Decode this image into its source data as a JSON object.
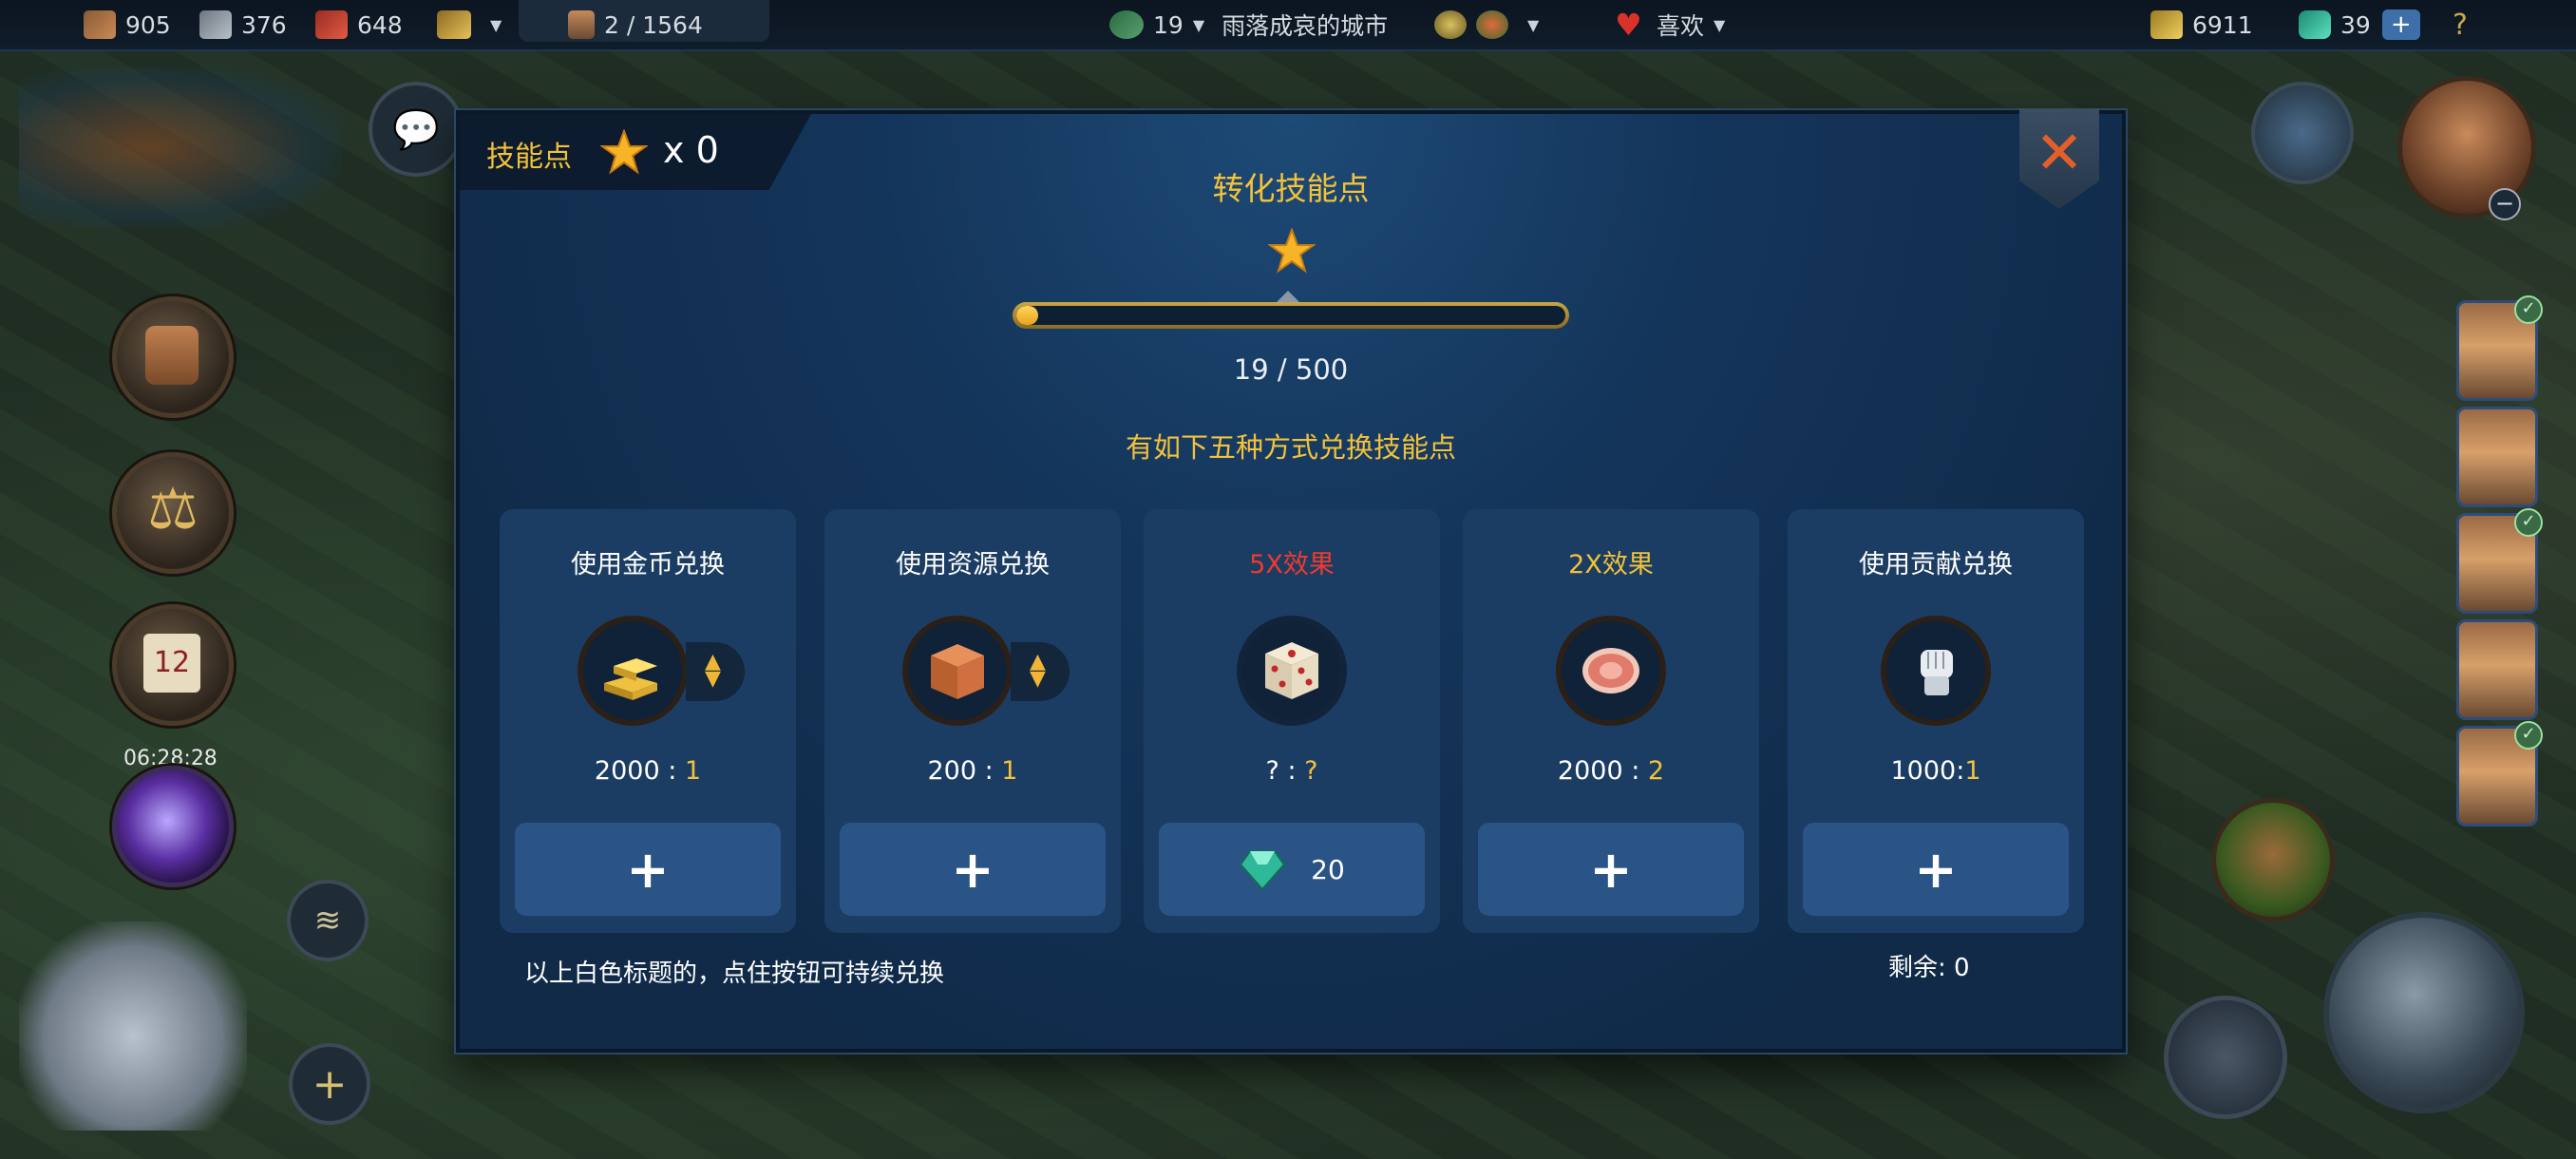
{
  "topbar": {
    "wood": "905",
    "stone": "376",
    "meat": "648",
    "population": "2 / 1564",
    "level": "19",
    "city_name": "雨落成哀的城市",
    "favor_label": "喜欢",
    "gold": "6911",
    "gems": "39",
    "help": "?"
  },
  "hud": {
    "timer": "06:28:28",
    "calendar_day": "12"
  },
  "dialog": {
    "skill_points_label": "技能点",
    "skill_points_count": "x 0",
    "title": "转化技能点",
    "progress_text": "19 / 500",
    "progress_value": 19,
    "progress_max": 500,
    "subtitle": "有如下五种方式兑换技能点",
    "cards": [
      {
        "title": "使用金币兑换",
        "ratio_left": "2000 : ",
        "ratio_right": "1",
        "button": "+",
        "icon": "gold-bars-icon"
      },
      {
        "title": "使用资源兑换",
        "ratio_left": "200 : ",
        "ratio_right": "1",
        "button": "+",
        "icon": "resource-cube-icon"
      },
      {
        "title": "5X效果",
        "ratio_left": "? : ",
        "ratio_right": "?",
        "button_gems": "20",
        "icon": "dice-icon"
      },
      {
        "title": "2X效果",
        "ratio_left": "2000 : ",
        "ratio_right": "2",
        "button": "+",
        "icon": "meat-icon"
      },
      {
        "title": "使用贡献兑换",
        "ratio_left": "1000:",
        "ratio_right": "1",
        "button": "+",
        "icon": "fist-icon"
      }
    ],
    "note": "以上白色标题的，点住按钮可持续兑换",
    "remaining": "剩余:  0"
  },
  "colors": {
    "accent_gold": "#f3c23a",
    "red_title": "#f03a2e",
    "card_bg": "#1c3d63",
    "button_bg": "#2b5486"
  }
}
